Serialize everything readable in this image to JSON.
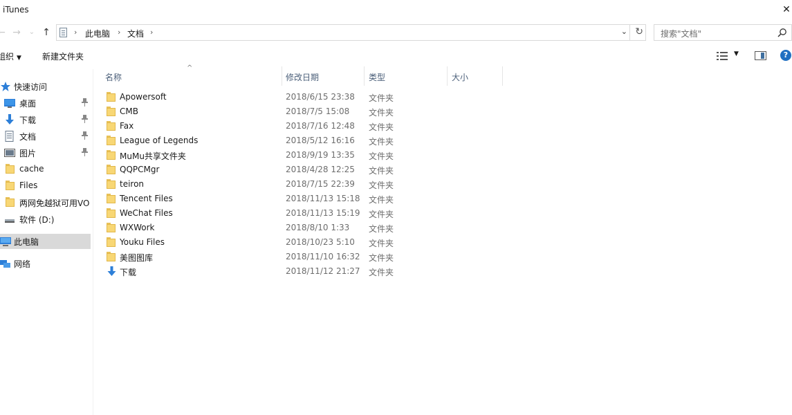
{
  "window": {
    "title": "iTunes",
    "close_glyph": "✕"
  },
  "nav_buttons": {
    "back": "←",
    "forward": "→",
    "recent": "⌄",
    "up": "↑"
  },
  "address": {
    "breadcrumbs": [
      "此电脑",
      "文档"
    ],
    "separator": "›",
    "dropdown_glyph": "⌄",
    "refresh_glyph": "↻"
  },
  "search": {
    "placeholder": "搜索\"文档\""
  },
  "toolbar": {
    "organize_label": "组织",
    "organize_caret": "▼",
    "new_folder_label": "新建文件夹",
    "view_caret": "▼",
    "help_label": "?"
  },
  "nav_pane": {
    "items": [
      {
        "label": "快速访问",
        "icon": "star-icon"
      },
      {
        "label": "桌面",
        "icon": "desktop-icon",
        "pinned": true
      },
      {
        "label": "下载",
        "icon": "download-arrow-icon",
        "pinned": true
      },
      {
        "label": "文档",
        "icon": "document-icon",
        "pinned": true
      },
      {
        "label": "图片",
        "icon": "pictures-icon",
        "pinned": true
      },
      {
        "label": "cache",
        "icon": "folder-icon"
      },
      {
        "label": "Files",
        "icon": "folder-icon"
      },
      {
        "label": "两网免越狱可用VO",
        "icon": "folder-icon"
      },
      {
        "label": "软件 (D:)",
        "icon": "drive-icon"
      },
      {
        "label": "此电脑",
        "icon": "computer-icon",
        "selected": true
      },
      {
        "label": "网络",
        "icon": "network-icon"
      }
    ]
  },
  "file_list": {
    "sort_glyph": "^",
    "columns": [
      "名称",
      "修改日期",
      "类型",
      "大小"
    ],
    "rows": [
      {
        "name": "Apowersoft",
        "date": "2018/6/15 23:38",
        "type": "文件夹",
        "size": "",
        "icon": "folder-icon"
      },
      {
        "name": "CMB",
        "date": "2018/7/5 15:08",
        "type": "文件夹",
        "size": "",
        "icon": "folder-icon"
      },
      {
        "name": "Fax",
        "date": "2018/7/16 12:48",
        "type": "文件夹",
        "size": "",
        "icon": "folder-icon"
      },
      {
        "name": "League of Legends",
        "date": "2018/5/12 16:16",
        "type": "文件夹",
        "size": "",
        "icon": "folder-icon"
      },
      {
        "name": "MuMu共享文件夹",
        "date": "2018/9/19 13:35",
        "type": "文件夹",
        "size": "",
        "icon": "folder-icon"
      },
      {
        "name": "QQPCMgr",
        "date": "2018/4/28 12:25",
        "type": "文件夹",
        "size": "",
        "icon": "folder-icon"
      },
      {
        "name": "teiron",
        "date": "2018/7/15 22:39",
        "type": "文件夹",
        "size": "",
        "icon": "folder-icon"
      },
      {
        "name": "Tencent Files",
        "date": "2018/11/13 15:18",
        "type": "文件夹",
        "size": "",
        "icon": "folder-icon"
      },
      {
        "name": "WeChat Files",
        "date": "2018/11/13 15:19",
        "type": "文件夹",
        "size": "",
        "icon": "folder-icon"
      },
      {
        "name": "WXWork",
        "date": "2018/8/10 1:33",
        "type": "文件夹",
        "size": "",
        "icon": "folder-icon"
      },
      {
        "name": "Youku Files",
        "date": "2018/10/23 5:10",
        "type": "文件夹",
        "size": "",
        "icon": "folder-icon"
      },
      {
        "name": "美图图库",
        "date": "2018/11/10 16:32",
        "type": "文件夹",
        "size": "",
        "icon": "folder-icon"
      },
      {
        "name": "下载",
        "date": "2018/11/12 21:27",
        "type": "文件夹",
        "size": "",
        "icon": "download-arrow-icon"
      }
    ]
  },
  "colors": {
    "folder_fill": "#f8d775",
    "accent_blue": "#1f6fc1",
    "selected_bg": "#d9d9d9",
    "header_text": "#4c607a",
    "meta_text": "#6d6d6d"
  }
}
